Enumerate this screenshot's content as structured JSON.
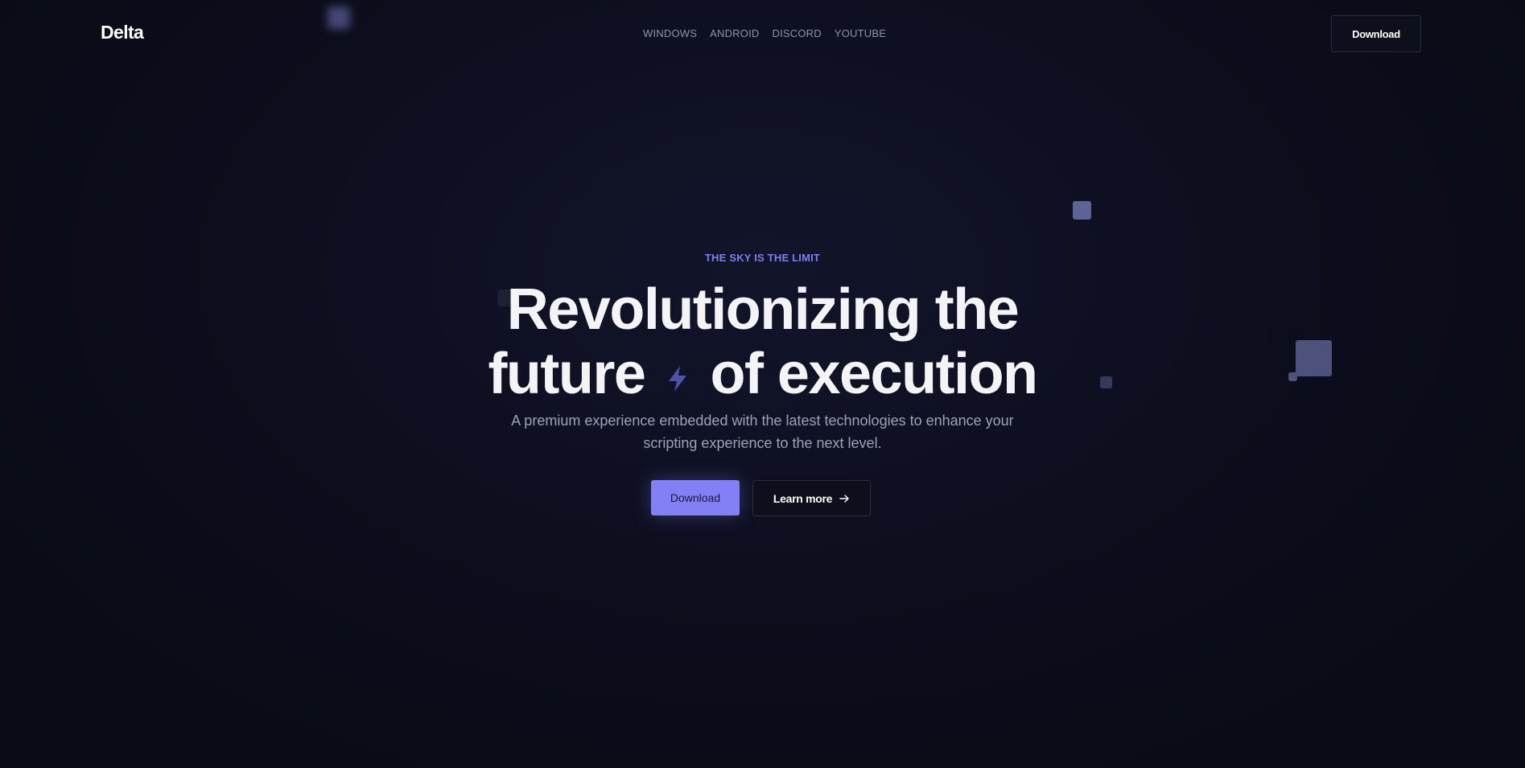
{
  "header": {
    "logo": "Delta",
    "nav": [
      {
        "label": "WINDOWS"
      },
      {
        "label": "ANDROID"
      },
      {
        "label": "DISCORD"
      },
      {
        "label": "YOUTUBE"
      }
    ],
    "download_label": "Download"
  },
  "hero": {
    "eyebrow": "THE SKY IS THE LIMIT",
    "headline_line1": "Revolutionizing the",
    "headline_line2_a": "future",
    "headline_line2_b": "of execution",
    "subtitle_line1": "A premium experience embedded with the latest technologies to enhance your",
    "subtitle_line2": "scripting experience to the next level.",
    "primary_button": "Download",
    "secondary_button": "Learn more"
  },
  "colors": {
    "background": "#0d0e1c",
    "accent": "#8380f6",
    "eyebrow": "#7e7df0",
    "muted_text": "#9ea2b6"
  },
  "icons": {
    "bolt": "lightning-bolt-icon",
    "arrow": "arrow-right-icon"
  }
}
